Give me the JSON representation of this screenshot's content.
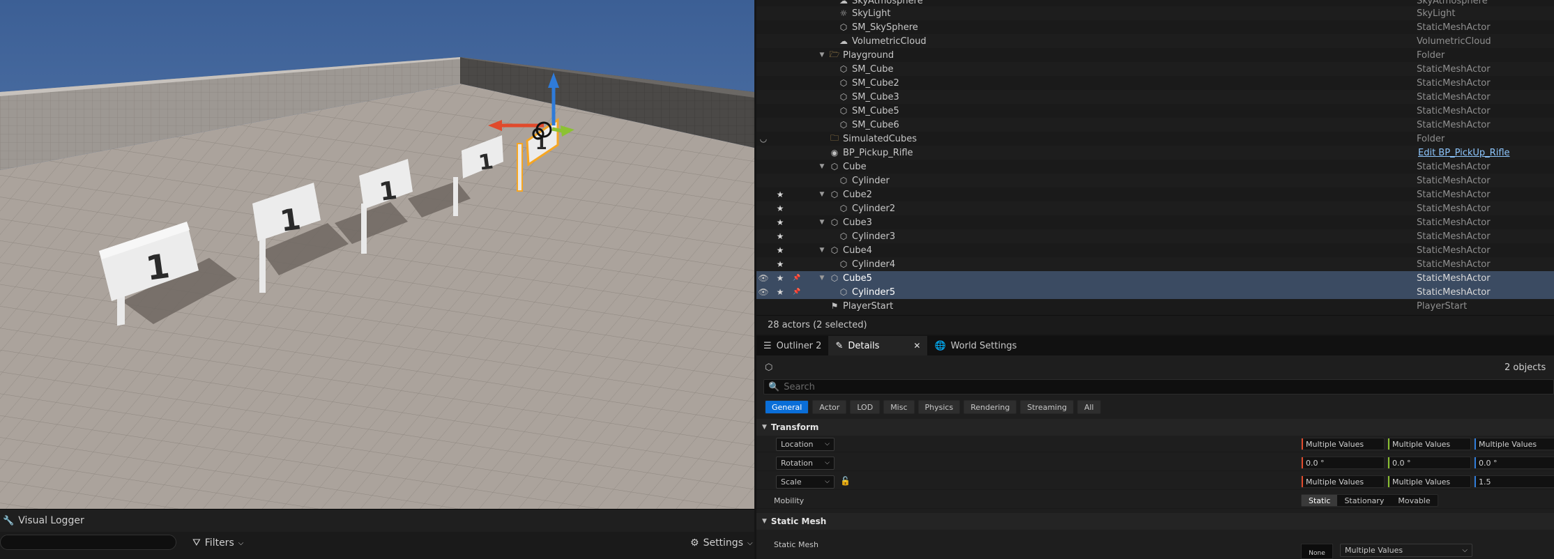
{
  "outliner": {
    "rows": [
      {
        "label": "SkyAtmosphere",
        "type": "SkyAtmosphere",
        "icon": "sky-atmosphere-icon"
      },
      {
        "label": "SkyLight",
        "type": "SkyLight",
        "icon": "skylight-icon"
      },
      {
        "label": "SM_SkySphere",
        "type": "StaticMeshActor",
        "icon": "static-mesh-icon"
      },
      {
        "label": "VolumetricCloud",
        "type": "VolumetricCloud",
        "icon": "cloud-icon"
      },
      {
        "label": "Playground",
        "type": "Folder",
        "icon": "folder-open-icon"
      },
      {
        "label": "SM_Cube",
        "type": "StaticMeshActor",
        "icon": "static-mesh-icon"
      },
      {
        "label": "SM_Cube2",
        "type": "StaticMeshActor",
        "icon": "static-mesh-icon"
      },
      {
        "label": "SM_Cube3",
        "type": "StaticMeshActor",
        "icon": "static-mesh-icon"
      },
      {
        "label": "SM_Cube5",
        "type": "StaticMeshActor",
        "icon": "static-mesh-icon"
      },
      {
        "label": "SM_Cube6",
        "type": "StaticMeshActor",
        "icon": "static-mesh-icon"
      },
      {
        "label": "SimulatedCubes",
        "type": "Folder",
        "icon": "folder-icon"
      },
      {
        "label": "BP_Pickup_Rifle",
        "type": "Edit BP_PickUp_Rifle",
        "icon": "blueprint-icon"
      },
      {
        "label": "Cube",
        "type": "StaticMeshActor",
        "icon": "static-mesh-icon"
      },
      {
        "label": "Cylinder",
        "type": "StaticMeshActor",
        "icon": "static-mesh-icon"
      },
      {
        "label": "Cube2",
        "type": "StaticMeshActor",
        "icon": "static-mesh-icon"
      },
      {
        "label": "Cylinder2",
        "type": "StaticMeshActor",
        "icon": "static-mesh-icon"
      },
      {
        "label": "Cube3",
        "type": "StaticMeshActor",
        "icon": "static-mesh-icon"
      },
      {
        "label": "Cylinder3",
        "type": "StaticMeshActor",
        "icon": "static-mesh-icon"
      },
      {
        "label": "Cube4",
        "type": "StaticMeshActor",
        "icon": "static-mesh-icon"
      },
      {
        "label": "Cylinder4",
        "type": "StaticMeshActor",
        "icon": "static-mesh-icon"
      },
      {
        "label": "Cube5",
        "type": "StaticMeshActor",
        "icon": "static-mesh-icon"
      },
      {
        "label": "Cylinder5",
        "type": "StaticMeshActor",
        "icon": "static-mesh-icon"
      },
      {
        "label": "PlayerStart",
        "type": "PlayerStart",
        "icon": "player-start-icon"
      }
    ],
    "footer": "28 actors (2 selected)"
  },
  "tabs": {
    "outliner2": "Outliner 2",
    "details": "Details",
    "world_settings": "World Settings",
    "close": "✕"
  },
  "details": {
    "object_count": "2 objects",
    "search_placeholder": "Search",
    "filters": [
      "General",
      "Actor",
      "LOD",
      "Misc",
      "Physics",
      "Rendering",
      "Streaming",
      "All"
    ],
    "transform_header": "Transform",
    "location_label": "Location",
    "rotation_label": "Rotation",
    "scale_label": "Scale",
    "location_values": [
      "Multiple Values",
      "Multiple Values",
      "Multiple Values"
    ],
    "rotation_values": [
      "0.0 °",
      "0.0 °",
      "0.0 °"
    ],
    "scale_values": [
      "Multiple Values",
      "Multiple Values",
      "1.5"
    ],
    "mobility_label": "Mobility",
    "mobility_options": [
      "Static",
      "Stationary",
      "Movable"
    ],
    "static_mesh_header": "Static Mesh",
    "static_mesh_label": "Static Mesh",
    "static_mesh_thumb": "None",
    "static_mesh_value": "Multiple Values"
  },
  "viewport": {
    "sign_text": "1"
  },
  "visual_logger": {
    "title": "Visual Logger",
    "filters_label": "Filters",
    "settings_label": "Settings"
  },
  "colors": {
    "selection": "#3b4b62",
    "accent_blue": "#0a6ed8",
    "axis_x": "#e04a2c",
    "axis_y": "#8cc232",
    "axis_z": "#2f7bd9"
  }
}
